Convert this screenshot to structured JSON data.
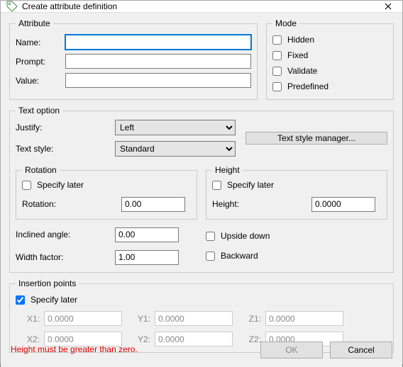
{
  "window": {
    "title": "Create attribute definition"
  },
  "attribute": {
    "legend": "Attribute",
    "name_label": "Name:",
    "name_value": "",
    "prompt_label": "Prompt:",
    "prompt_value": "",
    "value_label": "Value:",
    "value_value": ""
  },
  "mode": {
    "legend": "Mode",
    "hidden": "Hidden",
    "hidden_checked": false,
    "fixed": "Fixed",
    "fixed_checked": false,
    "validate": "Validate",
    "validate_checked": false,
    "predefined": "Predefined",
    "predefined_checked": false
  },
  "text_option": {
    "legend": "Text option",
    "justify_label": "Justify:",
    "justify_value": "Left",
    "text_style_label": "Text style:",
    "text_style_value": "Standard",
    "style_mgr_btn": "Text style manager...",
    "rotation": {
      "legend": "Rotation",
      "specify": "Specify later",
      "specify_checked": false,
      "label": "Rotation:",
      "value": "0.00"
    },
    "height": {
      "legend": "Height",
      "specify": "Specify later",
      "specify_checked": false,
      "label": "Height:",
      "value": "0.0000"
    },
    "inclined_label": "Inclined angle:",
    "inclined_value": "0.00",
    "width_label": "Width factor:",
    "width_value": "1.00",
    "upside_down": "Upside down",
    "upside_down_checked": false,
    "backward": "Backward",
    "backward_checked": false
  },
  "insertion": {
    "legend": "Insertion points",
    "specify": "Specify later",
    "specify_checked": true,
    "x1_label": "X1:",
    "x1": "0.0000",
    "y1_label": "Y1:",
    "y1": "0.0000",
    "z1_label": "Z1:",
    "z1": "0.0000",
    "x2_label": "X2:",
    "x2": "0.0000",
    "y2_label": "Y2:",
    "y2": "0.0000",
    "z2_label": "Z2:",
    "z2": "0.0000"
  },
  "error_message": "Height must be greater than zero.",
  "buttons": {
    "ok": "OK",
    "cancel": "Cancel"
  }
}
